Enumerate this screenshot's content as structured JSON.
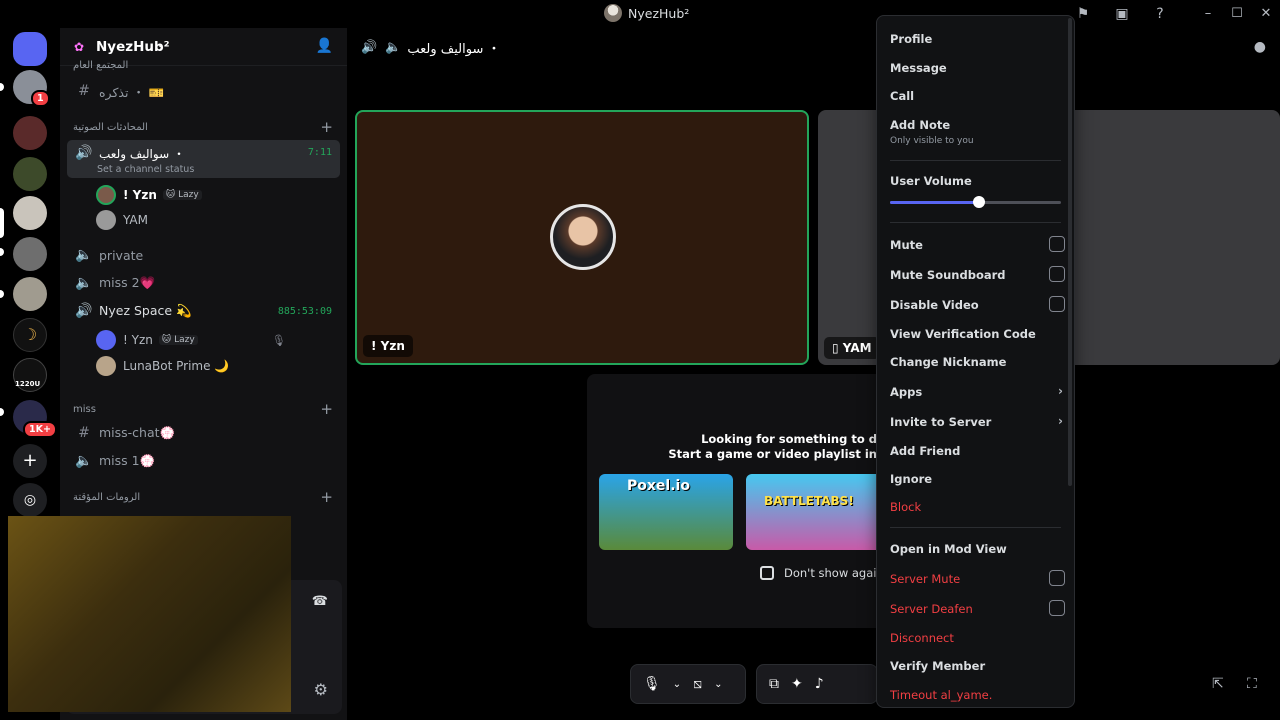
{
  "window": {
    "title": "NyezHub²"
  },
  "server": {
    "name": "NyezHub²",
    "badges": {
      "first": "1",
      "many": "1K+"
    },
    "rail_label": "1220U"
  },
  "channels": {
    "top_category": "المجتمع العام",
    "text_channel_1": "تذكره ・ 🎫",
    "voice_category": "المحادثات الصوتية",
    "active_voice": {
      "name": "سواليف ولعب ・",
      "status": "Set a channel status",
      "time": "7:11",
      "members": [
        {
          "name": "! Yzn",
          "tag": "🐱 Lazy"
        },
        {
          "name": "YAM"
        }
      ]
    },
    "private": "private",
    "miss2": "miss 2💗",
    "nyez_space": {
      "name": "Nyez Space 💫",
      "time": "885:53:09",
      "members": [
        {
          "name": "! Yzn",
          "tag": "🐱 Lazy"
        },
        {
          "name": "LunaBot Prime 🌙"
        }
      ]
    },
    "miss_category": "miss",
    "miss_chat": "miss-chat💮",
    "miss1": "miss 1💮",
    "temp_category": "الرومات المؤقتة"
  },
  "stage": {
    "header": "سواليف ولعب ・",
    "tile1_name": "! Yzn",
    "tile2_name": "YAM",
    "activity": {
      "line1": "Looking for something to d",
      "line2": "Start a game or video playlist in",
      "game1": "Poxel.io",
      "game2": "BATTLETABS!",
      "dont_show": "Don't show again"
    }
  },
  "context_menu": {
    "profile": "Profile",
    "message": "Message",
    "call": "Call",
    "add_note": "Add Note",
    "add_note_sub": "Only visible to you",
    "user_volume": "User Volume",
    "user_volume_level": 0.52,
    "mute": "Mute",
    "mute_soundboard": "Mute Soundboard",
    "disable_video": "Disable Video",
    "view_verification": "View Verification Code",
    "change_nickname": "Change Nickname",
    "apps": "Apps",
    "invite": "Invite to Server",
    "add_friend": "Add Friend",
    "ignore": "Ignore",
    "block": "Block",
    "mod_view": "Open in Mod View",
    "server_mute": "Server Mute",
    "server_deafen": "Server Deafen",
    "disconnect": "Disconnect",
    "verify": "Verify Member",
    "timeout": "Timeout al_yame."
  },
  "colors": {
    "accent": "#5865f2",
    "danger": "#f23f43",
    "online": "#23a55a"
  }
}
